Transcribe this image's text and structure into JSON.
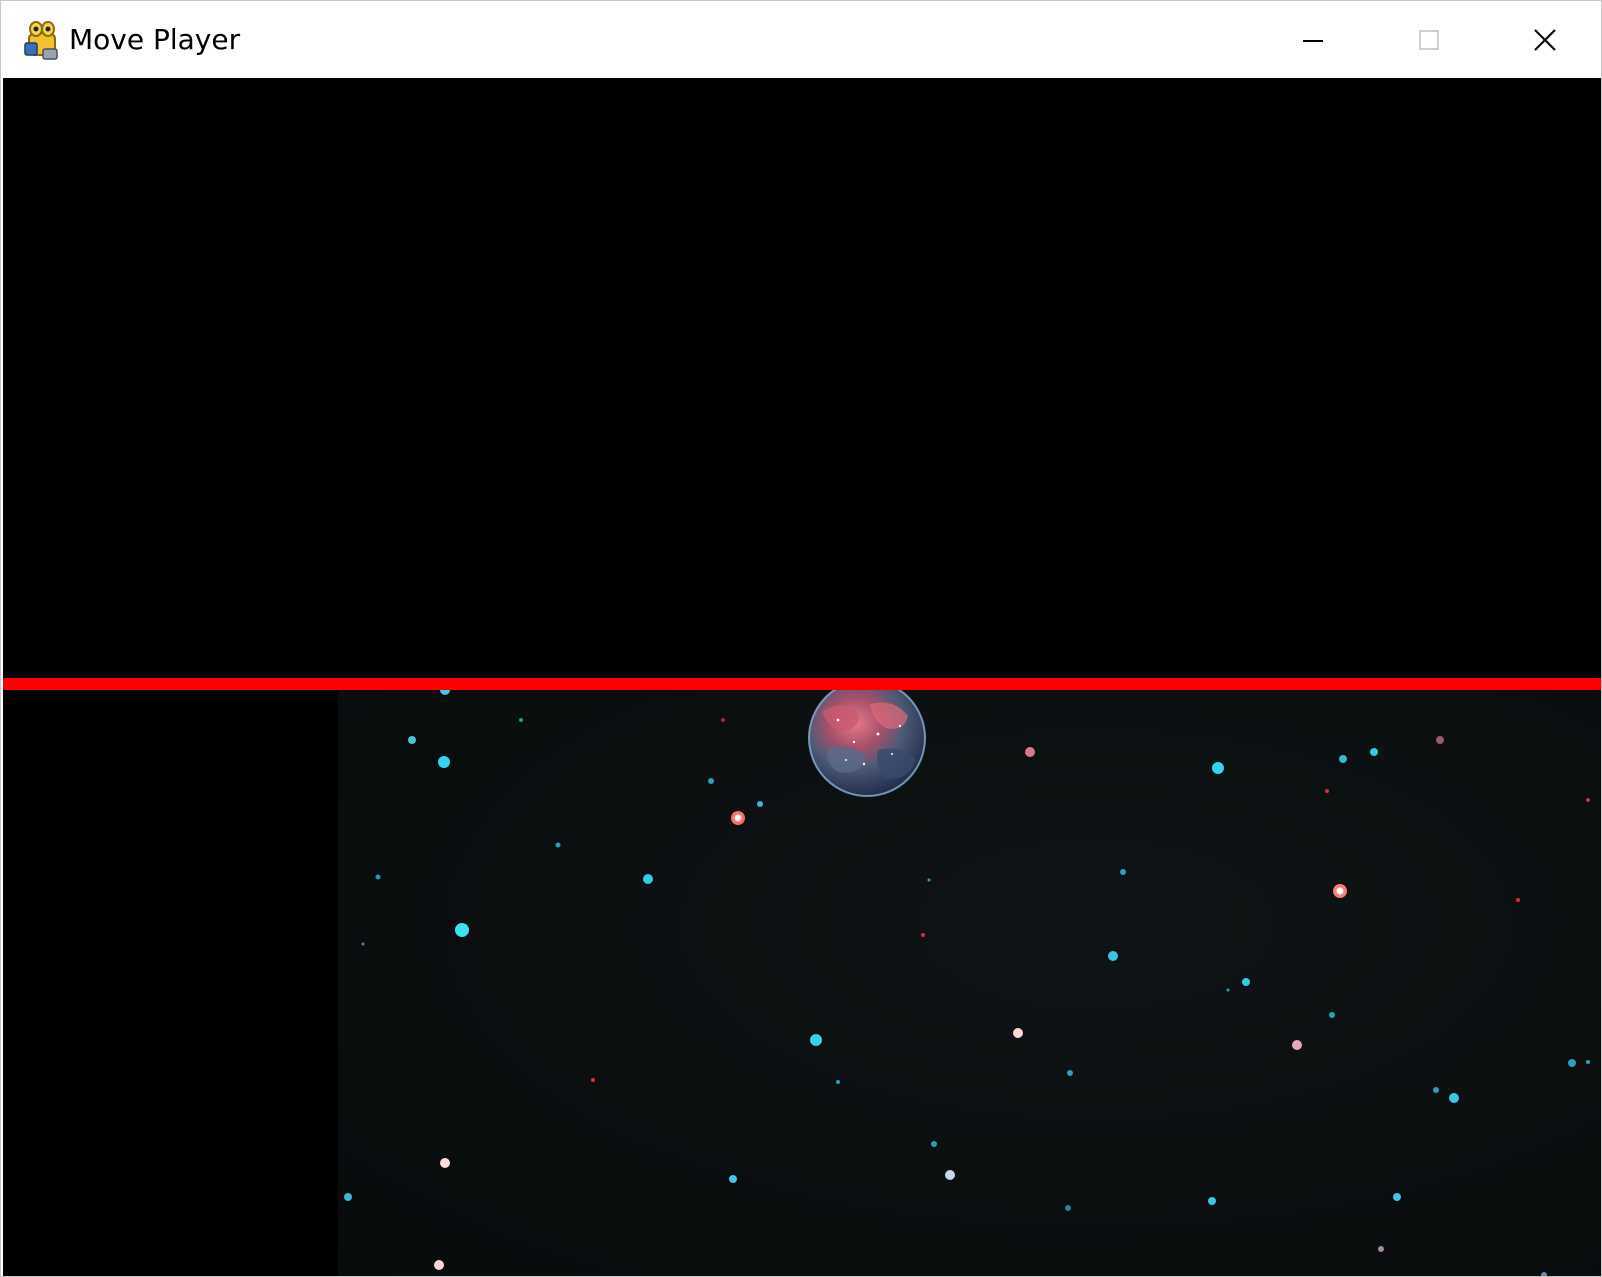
{
  "window": {
    "title": "Move Player",
    "app_icon": "pygame-snake-icon",
    "controls": {
      "minimize_icon": "minimize-icon",
      "maximize_icon": "maximize-icon",
      "close_icon": "close-icon"
    }
  },
  "game": {
    "background_color": "#000000",
    "boundary_line_color": "#ff0000",
    "space_background_color": "#0b0f10",
    "player_sprite": "planet-earth-sprite"
  }
}
